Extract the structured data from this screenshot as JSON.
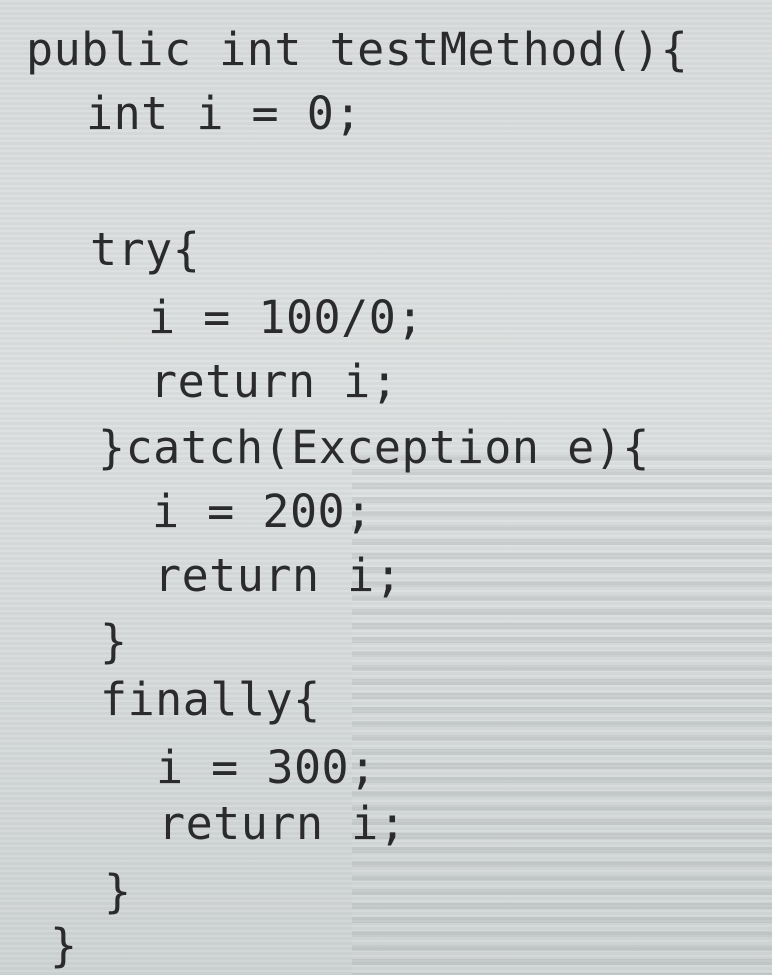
{
  "code": {
    "lines": [
      "public int testMethod(){",
      "int i = 0;",
      "try{",
      "i = 100/0;",
      "return i;",
      "}catch(Exception e){",
      "i = 200;",
      "return i;",
      "}",
      "finally{",
      "i = 300;",
      "return i;",
      "}",
      "}"
    ]
  }
}
